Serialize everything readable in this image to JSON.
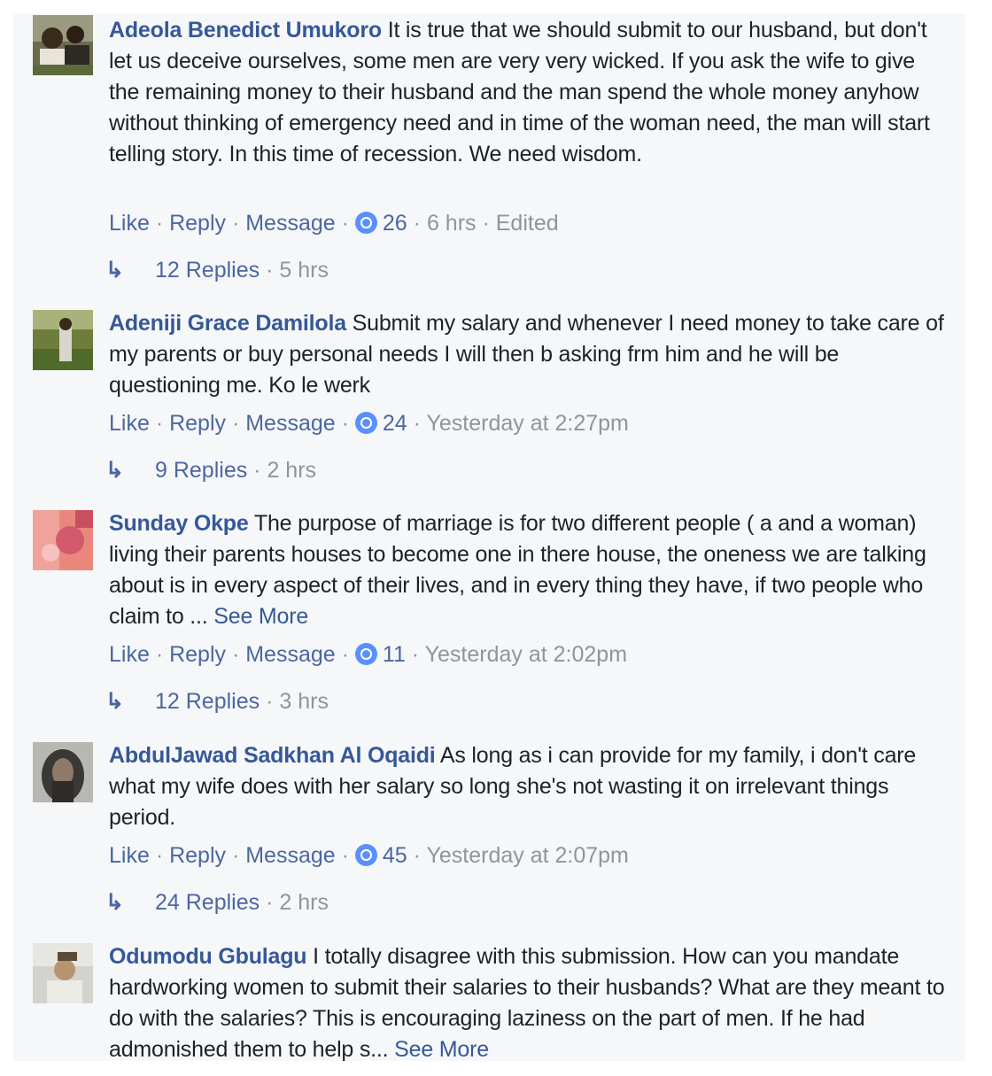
{
  "comments": [
    {
      "author": "Adeola Benedict Umukoro",
      "text": " It is true that we should submit to our husband, but don't let us deceive ourselves, some men are very very wicked. If you ask the wife to give the remaining money to their husband and the man spend the whole money anyhow without thinking of emergency need and in time of the woman need, the man will start telling story. In this time of recession. We need wisdom.",
      "see_more": "",
      "actions": {
        "like": "Like",
        "reply": "Reply",
        "message": "Message",
        "sep": " · "
      },
      "likes": "26",
      "time": "6 hrs",
      "edited": "Edited",
      "replies_label": "12 Replies",
      "replies_time": "5 hrs"
    },
    {
      "author": "Adeniji Grace Damilola",
      "text": " Submit my salary and whenever I need money to take care of my parents or buy personal needs I will then b asking frm him and he will be questioning me. Ko le werk",
      "see_more": "",
      "actions": {
        "like": "Like",
        "reply": "Reply",
        "message": "Message",
        "sep": " · "
      },
      "likes": "24",
      "time": "Yesterday at 2:27pm",
      "edited": "",
      "replies_label": "9 Replies",
      "replies_time": "2 hrs"
    },
    {
      "author": "Sunday Okpe",
      "text": " The purpose of marriage is for two different people ( a and a woman) living their parents houses to become one in there house, the oneness we are talking about is in every aspect of their lives, and in every thing they have, if two people who claim to ... ",
      "see_more": "See More",
      "actions": {
        "like": "Like",
        "reply": "Reply",
        "message": "Message",
        "sep": " · "
      },
      "likes": "11",
      "time": "Yesterday at 2:02pm",
      "edited": "",
      "replies_label": "12 Replies",
      "replies_time": "3 hrs"
    },
    {
      "author": "AbdulJawad Sadkhan Al Oqaidi",
      "text": " As long as i can provide for my family, i don't care what my wife does with her salary so long she's not wasting it on irrelevant things period.",
      "see_more": "",
      "actions": {
        "like": "Like",
        "reply": "Reply",
        "message": "Message",
        "sep": " · "
      },
      "likes": "45",
      "time": "Yesterday at 2:07pm",
      "edited": "",
      "replies_label": "24 Replies",
      "replies_time": "2 hrs"
    },
    {
      "author": "Odumodu Gbulagu",
      "text": " I totally disagree with this submission. How can you mandate hardworking women to submit their salaries to their husbands? What are they meant to do with the salaries? This is encouraging laziness on the part of men. If he had admonished them to help s... ",
      "see_more": "See More"
    }
  ],
  "icons": {
    "like": "like-thumb-icon",
    "reply_arrow": "reply-arrow-icon"
  },
  "colors": {
    "author": "#365899",
    "link": "#4b67a1",
    "meta": "#90949c",
    "like_badge": "#5890ff",
    "panel_bg": "#f6f7f9"
  }
}
